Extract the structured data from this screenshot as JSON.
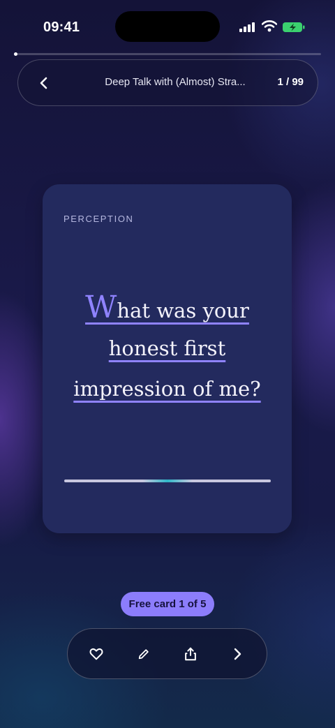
{
  "status_bar": {
    "time": "09:41",
    "icons": [
      "cellular-signal-icon",
      "wifi-icon",
      "battery-charging-icon"
    ],
    "battery_color": "#3bd16f"
  },
  "reading_progress": {
    "current": 1,
    "total": 99
  },
  "header": {
    "back_icon": "chevron-left-icon",
    "title": "Deep Talk with (Almost) Stra...",
    "counter": "1 / 99"
  },
  "card": {
    "category": "PERCEPTION",
    "question_lines": [
      {
        "dropcap": "W",
        "text": "hat was your"
      },
      {
        "text": "honest first"
      },
      {
        "text": "impression of me?"
      }
    ],
    "accent_color": "#8f83ff",
    "background_color": "#232a5e"
  },
  "free_badge": {
    "label": "Free card 1 of 5",
    "color": "#8c7dfb"
  },
  "toolbar": {
    "buttons": [
      {
        "name": "favorite",
        "icon": "heart-icon"
      },
      {
        "name": "edit",
        "icon": "pencil-icon"
      },
      {
        "name": "share",
        "icon": "share-icon"
      },
      {
        "name": "next",
        "icon": "chevron-right-icon"
      }
    ]
  }
}
